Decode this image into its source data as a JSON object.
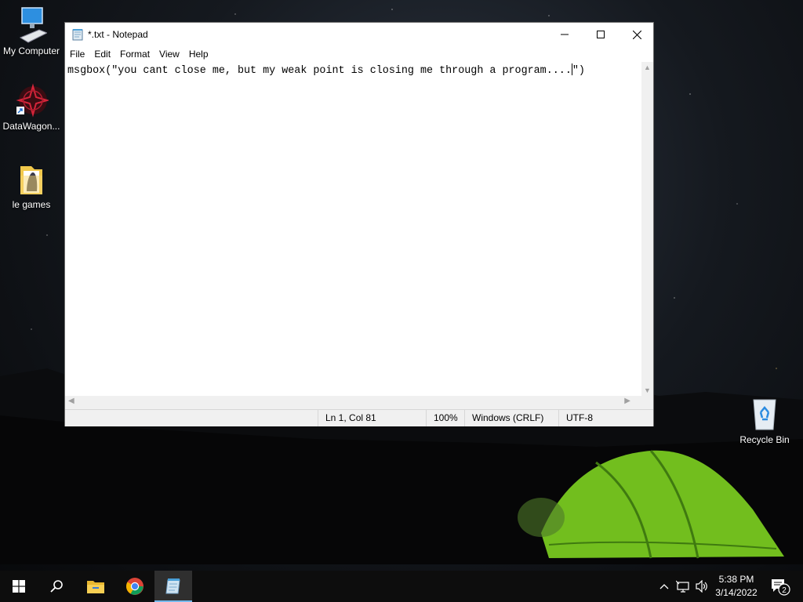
{
  "desktop": {
    "icons": [
      {
        "label": "My Computer"
      },
      {
        "label": "DataWagon..."
      },
      {
        "label": "le games"
      },
      {
        "label": "Recycle Bin"
      }
    ]
  },
  "window": {
    "title": "*.txt - Notepad",
    "menu": [
      "File",
      "Edit",
      "Format",
      "View",
      "Help"
    ],
    "content_before_caret": "msgbox(\"you cant close me, but my weak point is closing me through a program....",
    "content_after_caret": "\")",
    "status": {
      "position": "Ln 1, Col 81",
      "zoom": "100%",
      "line_ending": "Windows (CRLF)",
      "encoding": "UTF-8"
    }
  },
  "taskbar": {
    "time": "5:38 PM",
    "date": "3/14/2022",
    "notification_count": "2"
  },
  "colors": {
    "accent": "#76b9ed",
    "taskbar": "#0d0d0d",
    "tent": "#7ed321"
  }
}
